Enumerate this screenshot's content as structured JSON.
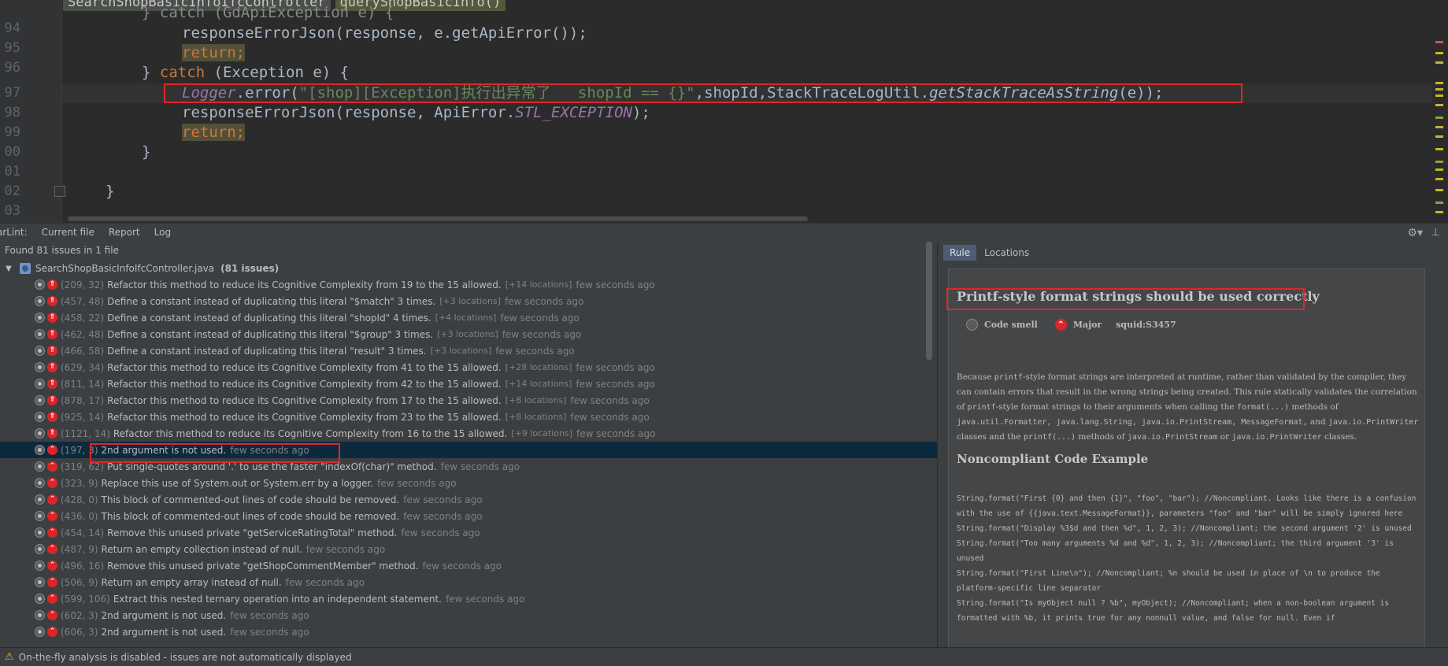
{
  "editor": {
    "breadcrumb": [
      "SearchShopBasicInfoIfcController",
      "queryShopBasicInfo()"
    ],
    "line_numbers": [
      "94",
      "95",
      "96",
      "97",
      "98",
      "99",
      "00",
      "01",
      "02",
      "03"
    ],
    "top_partial_line": "} catch (GdApiException e) {",
    "lines": {
      "l94": "responseErrorJson(response, e.getApiError());",
      "l95": "return;",
      "l96_a": "} ",
      "l96_kw": "catch",
      "l96_b": " (Exception e) {",
      "l97_logger": "Logger",
      "l97_a": ".error(",
      "l97_str": "\"[shop][Exception]执行出异常了   shopId == {}\"",
      "l97_b": ",shopId,StackTraceLogUtil.",
      "l97_m": "getStackTraceAsString",
      "l97_c": "(e));",
      "l98_a": "responseErrorJson(response, ApiError.",
      "l98_const": "STL_EXCEPTION",
      "l98_b": ");",
      "l99": "return;",
      "l00": "}",
      "l02": "}"
    }
  },
  "toolwindow": {
    "tabs": [
      "arLint:",
      "Current file",
      "Report",
      "Log"
    ]
  },
  "issues": {
    "summary": "Found 81 issues in 1 file",
    "file": "SearchShopBasicInfoIfcController.java",
    "file_count": "(81 issues)",
    "items": [
      {
        "loc": "(209, 32)",
        "msg": "Refactor this method to reduce its Cognitive Complexity from 19 to the 15 allowed.",
        "extra": "[+14 locations]",
        "age": "few seconds ago",
        "sev": "critical"
      },
      {
        "loc": "(457, 48)",
        "msg": "Define a constant instead of duplicating this literal \"$match\" 3 times.",
        "extra": "[+3 locations]",
        "age": "few seconds ago",
        "sev": "critical"
      },
      {
        "loc": "(458, 22)",
        "msg": "Define a constant instead of duplicating this literal \"shopId\" 4 times.",
        "extra": "[+4 locations]",
        "age": "few seconds ago",
        "sev": "critical"
      },
      {
        "loc": "(462, 48)",
        "msg": "Define a constant instead of duplicating this literal \"$group\" 3 times.",
        "extra": "[+3 locations]",
        "age": "few seconds ago",
        "sev": "critical"
      },
      {
        "loc": "(466, 58)",
        "msg": "Define a constant instead of duplicating this literal \"result\" 3 times.",
        "extra": "[+3 locations]",
        "age": "few seconds ago",
        "sev": "critical"
      },
      {
        "loc": "(629, 34)",
        "msg": "Refactor this method to reduce its Cognitive Complexity from 41 to the 15 allowed.",
        "extra": "[+28 locations]",
        "age": "few seconds ago",
        "sev": "critical"
      },
      {
        "loc": "(811, 14)",
        "msg": "Refactor this method to reduce its Cognitive Complexity from 42 to the 15 allowed.",
        "extra": "[+14 locations]",
        "age": "few seconds ago",
        "sev": "critical"
      },
      {
        "loc": "(878, 17)",
        "msg": "Refactor this method to reduce its Cognitive Complexity from 17 to the 15 allowed.",
        "extra": "[+8 locations]",
        "age": "few seconds ago",
        "sev": "critical"
      },
      {
        "loc": "(925, 14)",
        "msg": "Refactor this method to reduce its Cognitive Complexity from 23 to the 15 allowed.",
        "extra": "[+8 locations]",
        "age": "few seconds ago",
        "sev": "critical"
      },
      {
        "loc": "(1121, 14)",
        "msg": "Refactor this method to reduce its Cognitive Complexity from 16 to the 15 allowed.",
        "extra": "[+9 locations]",
        "age": "few seconds ago",
        "sev": "critical"
      },
      {
        "loc": "(197, 3)",
        "msg": "2nd argument is not used.",
        "extra": "",
        "age": "few seconds ago",
        "sev": "major",
        "selected": true
      },
      {
        "loc": "(319, 62)",
        "msg": "Put single-quotes around '.' to use the faster \"indexOf(char)\" method.",
        "extra": "",
        "age": "few seconds ago",
        "sev": "major"
      },
      {
        "loc": "(323, 9)",
        "msg": "Replace this use of System.out or System.err by a logger.",
        "extra": "",
        "age": "few seconds ago",
        "sev": "major"
      },
      {
        "loc": "(428, 0)",
        "msg": "This block of commented-out lines of code should be removed.",
        "extra": "",
        "age": "few seconds ago",
        "sev": "major"
      },
      {
        "loc": "(436, 0)",
        "msg": "This block of commented-out lines of code should be removed.",
        "extra": "",
        "age": "few seconds ago",
        "sev": "major"
      },
      {
        "loc": "(454, 14)",
        "msg": "Remove this unused private \"getServiceRatingTotal\" method.",
        "extra": "",
        "age": "few seconds ago",
        "sev": "major"
      },
      {
        "loc": "(487, 9)",
        "msg": "Return an empty collection instead of null.",
        "extra": "",
        "age": "few seconds ago",
        "sev": "major"
      },
      {
        "loc": "(496, 16)",
        "msg": "Remove this unused private \"getShopCommentMember\" method.",
        "extra": "",
        "age": "few seconds ago",
        "sev": "major"
      },
      {
        "loc": "(506, 9)",
        "msg": "Return an empty array instead of null.",
        "extra": "",
        "age": "few seconds ago",
        "sev": "major"
      },
      {
        "loc": "(599, 106)",
        "msg": "Extract this nested ternary operation into an independent statement.",
        "extra": "",
        "age": "few seconds ago",
        "sev": "major"
      },
      {
        "loc": "(602, 3)",
        "msg": "2nd argument is not used.",
        "extra": "",
        "age": "few seconds ago",
        "sev": "major"
      },
      {
        "loc": "(606, 3)",
        "msg": "2nd argument is not used.",
        "extra": "",
        "age": "few seconds ago",
        "sev": "major"
      }
    ]
  },
  "rule": {
    "tabs": [
      "Rule",
      "Locations"
    ],
    "title": "Printf-style format strings should be used correctly",
    "type": "Code smell",
    "severity": "Major",
    "key": "squid:S3457",
    "desc_1": "Because ",
    "desc_printf": "printf",
    "desc_2": "-style format strings are interpreted at runtime, rather than validated by the compiler, they can contain errors that result in the wrong strings being created. This rule statically validates the correlation of ",
    "desc_printf2": "printf",
    "desc_3": "-style format strings to their arguments when calling the ",
    "desc_format": "format(...)",
    "desc_4": " methods of ",
    "desc_classes": "java.util.Formatter, java.lang.String, java.io.PrintStream, MessageFormat,",
    "desc_5": " and ",
    "desc_pw": "java.io.PrintWriter",
    "desc_6": " classes and the ",
    "desc_printf3": "printf(...)",
    "desc_7": " methods of ",
    "desc_ps": "java.io.PrintStream",
    "desc_8": " or ",
    "desc_pw2": "java.io.PrintWriter",
    "desc_9": " classes.",
    "nc_heading": "Noncompliant Code Example",
    "nc_code": "String.format(\"First {0} and then {1}\", \"foo\", \"bar\"); //Noncompliant. Looks like there is a confusion with the use of {{java.text.MessageFormat}}, parameters \"foo\" and \"bar\" will be simply ignored here\nString.format(\"Display %3$d and then %d\", 1, 2, 3); //Noncompliant; the second argument '2' is unused\nString.format(\"Too many arguments %d and %d\", 1, 2, 3); //Noncompliant; the third argument '3' is unused\nString.format(\"First Line\\n\"); //Noncompliant; %n should be used in place of \\n to produce the platform-specific line separator\nString.format(\"Is myObject null ? %b\", myObject); //Noncompliant; when a non-boolean argument is formatted with %b, it prints true for any nonnull value, and false for null. Even if"
  },
  "status": {
    "text": "On-the-fly analysis is disabled - issues are not automatically displayed"
  },
  "colors": {
    "accent_red": "#e0262a",
    "selection": "#0d293e",
    "keyword": "#cc7832",
    "string": "#6a8759"
  }
}
